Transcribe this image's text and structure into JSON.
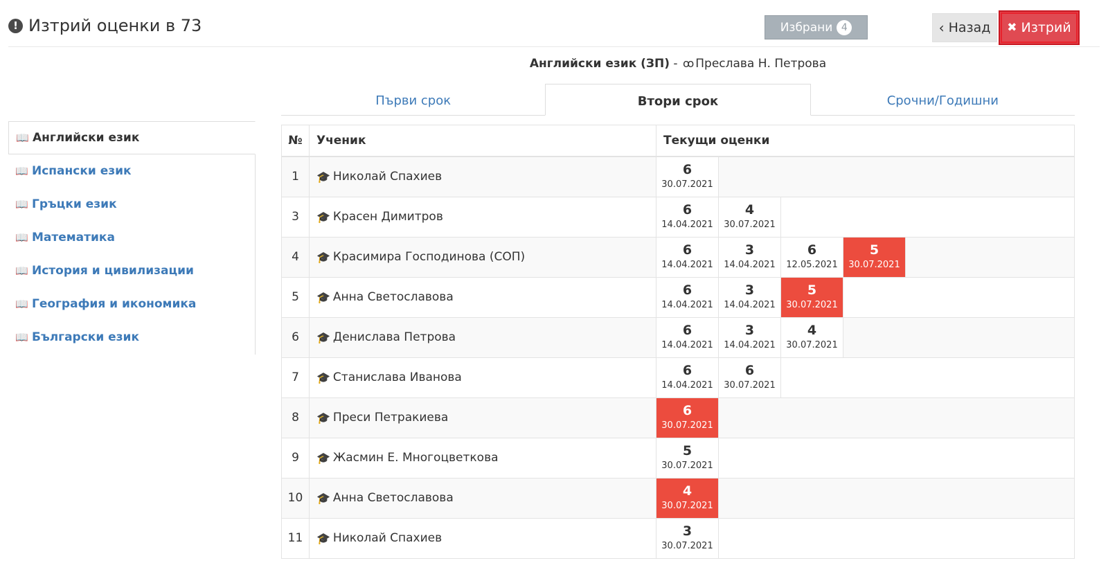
{
  "header": {
    "title": "Изтрий оценки в 73",
    "favorites_label": "Избрани",
    "favorites_count": "4",
    "back_label": "Назад",
    "delete_label": "Изтрий"
  },
  "subject_line": {
    "subject": "Английски език (ЗП)",
    "separator": " - ",
    "teacher": "Преслава Н. Петрова"
  },
  "tabs": [
    {
      "label": "Първи срок",
      "active": false
    },
    {
      "label": "Втори срок",
      "active": true
    },
    {
      "label": "Срочни/Годишни",
      "active": false
    }
  ],
  "sidebar": {
    "items": [
      {
        "label": "Английски език",
        "active": true
      },
      {
        "label": "Испански език",
        "active": false
      },
      {
        "label": "Гръцки език",
        "active": false
      },
      {
        "label": "Математика",
        "active": false
      },
      {
        "label": "История и цивилизации",
        "active": false
      },
      {
        "label": "География и икономика",
        "active": false
      },
      {
        "label": "Български език",
        "active": false
      }
    ]
  },
  "table": {
    "headers": {
      "no": "№",
      "student": "Ученик",
      "grades": "Текущи оценки"
    },
    "rows": [
      {
        "no": "1",
        "name": "Николай Спахиев",
        "grades": [
          {
            "value": "6",
            "date": "30.07.2021",
            "flag": false
          }
        ]
      },
      {
        "no": "3",
        "name": "Красен Димитров",
        "grades": [
          {
            "value": "6",
            "date": "14.04.2021",
            "flag": false
          },
          {
            "value": "4",
            "date": "30.07.2021",
            "flag": false
          }
        ]
      },
      {
        "no": "4",
        "name": "Красимира Господинова (СОП)",
        "grades": [
          {
            "value": "6",
            "date": "14.04.2021",
            "flag": false
          },
          {
            "value": "3",
            "date": "14.04.2021",
            "flag": false
          },
          {
            "value": "6",
            "date": "12.05.2021",
            "flag": false
          },
          {
            "value": "5",
            "date": "30.07.2021",
            "flag": true
          }
        ]
      },
      {
        "no": "5",
        "name": "Анна Светославова",
        "grades": [
          {
            "value": "6",
            "date": "14.04.2021",
            "flag": false
          },
          {
            "value": "3",
            "date": "14.04.2021",
            "flag": false
          },
          {
            "value": "5",
            "date": "30.07.2021",
            "flag": true
          }
        ]
      },
      {
        "no": "6",
        "name": "Денислава Петрова",
        "grades": [
          {
            "value": "6",
            "date": "14.04.2021",
            "flag": false
          },
          {
            "value": "3",
            "date": "14.04.2021",
            "flag": false
          },
          {
            "value": "4",
            "date": "30.07.2021",
            "flag": false
          }
        ]
      },
      {
        "no": "7",
        "name": "Станислава Иванова",
        "grades": [
          {
            "value": "6",
            "date": "14.04.2021",
            "flag": false
          },
          {
            "value": "6",
            "date": "30.07.2021",
            "flag": false
          }
        ]
      },
      {
        "no": "8",
        "name": "Преси Петракиева",
        "grades": [
          {
            "value": "6",
            "date": "30.07.2021",
            "flag": true
          }
        ]
      },
      {
        "no": "9",
        "name": "Жасмин Е. Многоцветкова",
        "grades": [
          {
            "value": "5",
            "date": "30.07.2021",
            "flag": false
          }
        ]
      },
      {
        "no": "10",
        "name": "Анна Светославова",
        "grades": [
          {
            "value": "4",
            "date": "30.07.2021",
            "flag": true
          }
        ]
      },
      {
        "no": "11",
        "name": "Николай Спахиев",
        "grades": [
          {
            "value": "3",
            "date": "30.07.2021",
            "flag": false
          }
        ]
      }
    ]
  },
  "icons": {
    "alert": "exclamation-circle-icon",
    "book": "book-icon",
    "student": "graduation-cap-icon",
    "teacher": "glasses-icon"
  },
  "colors": {
    "link": "#3d7ab8",
    "danger": "#ec4c3e",
    "delete_button": "#e04a52",
    "favorites_button": "#a4adb5"
  }
}
